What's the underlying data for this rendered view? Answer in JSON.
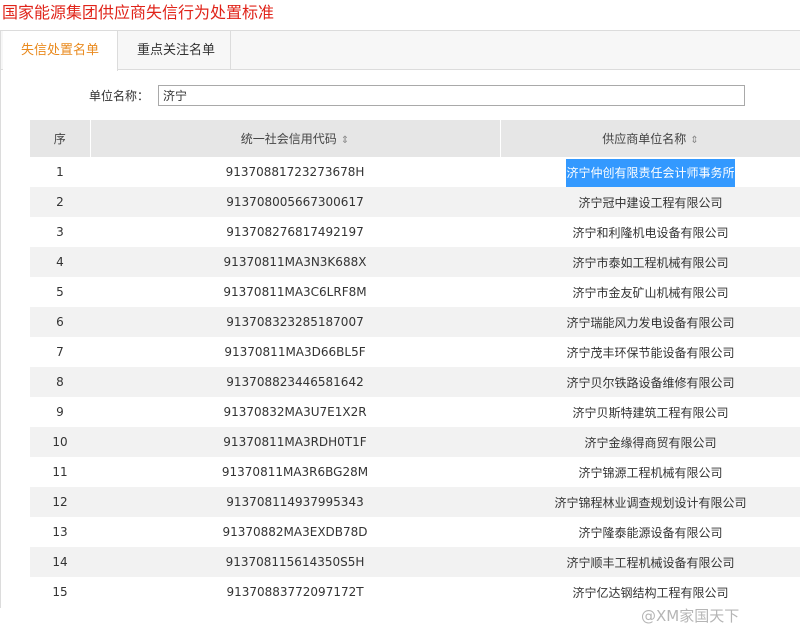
{
  "page": {
    "title": "国家能源集团供应商失信行为处置标准"
  },
  "tabs": [
    {
      "label": "失信处置名单",
      "active": true
    },
    {
      "label": "重点关注名单",
      "active": false
    }
  ],
  "filter": {
    "label": "单位名称：",
    "value": "济宁"
  },
  "table": {
    "headers": [
      "序",
      "统一社会信用代码",
      "供应商单位名称"
    ],
    "rows": [
      {
        "no": "1",
        "code": "91370881723273678H",
        "name": "济宁仲创有限责任会计师事务所"
      },
      {
        "no": "2",
        "code": "913708005667300617",
        "name": "济宁冠中建设工程有限公司"
      },
      {
        "no": "3",
        "code": "913708276817492197",
        "name": "济宁和利隆机电设备有限公司"
      },
      {
        "no": "4",
        "code": "91370811MA3N3K688X",
        "name": "济宁市泰如工程机械有限公司"
      },
      {
        "no": "5",
        "code": "91370811MA3C6LRF8M",
        "name": "济宁市金友矿山机械有限公司"
      },
      {
        "no": "6",
        "code": "913708323285187007",
        "name": "济宁瑞能风力发电设备有限公司"
      },
      {
        "no": "7",
        "code": "91370811MA3D66BL5F",
        "name": "济宁茂丰环保节能设备有限公司"
      },
      {
        "no": "8",
        "code": "913708823446581642",
        "name": "济宁贝尔铁路设备维修有限公司"
      },
      {
        "no": "9",
        "code": "91370832MA3U7E1X2R",
        "name": "济宁贝斯特建筑工程有限公司"
      },
      {
        "no": "10",
        "code": "91370811MA3RDH0T1F",
        "name": "济宁金缘得商贸有限公司"
      },
      {
        "no": "11",
        "code": "91370811MA3R6BG28M",
        "name": "济宁锦源工程机械有限公司"
      },
      {
        "no": "12",
        "code": "913708114937995343",
        "name": "济宁锦程林业调查规划设计有限公司"
      },
      {
        "no": "13",
        "code": "91370882MA3EXDB78D",
        "name": "济宁隆泰能源设备有限公司"
      },
      {
        "no": "14",
        "code": "913708115614350S5H",
        "name": "济宁顺丰工程机械设备有限公司"
      },
      {
        "no": "15",
        "code": "91370883772097172T",
        "name": "济宁亿达钢结构工程有限公司"
      }
    ]
  },
  "watermark": "@XM家国天下",
  "colors": {
    "title": "#e0241a",
    "active_tab": "#e98a1e",
    "highlight": "#3399ff"
  }
}
